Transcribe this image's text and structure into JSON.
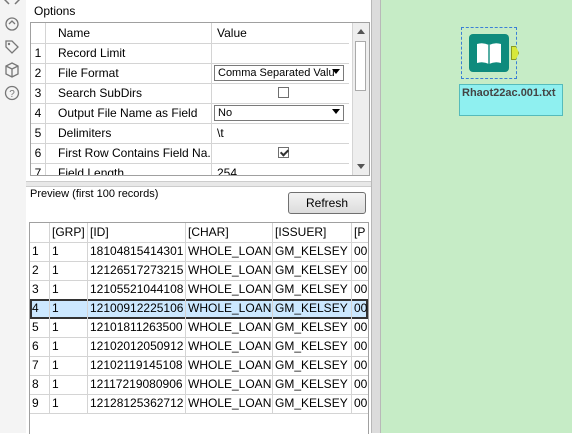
{
  "options": {
    "title": "Options",
    "columns": {
      "name": "Name",
      "value": "Value"
    },
    "rows": [
      {
        "num": "1",
        "name": "Record Limit",
        "value": ""
      },
      {
        "num": "2",
        "name": "File Format",
        "value": "Comma Separated Valu"
      },
      {
        "num": "3",
        "name": "Search SubDirs",
        "value": ""
      },
      {
        "num": "4",
        "name": "Output File Name as Field",
        "value": "No"
      },
      {
        "num": "5",
        "name": "Delimiters",
        "value": "\\t"
      },
      {
        "num": "6",
        "name": "First Row Contains Field Na...",
        "value": ""
      },
      {
        "num": "7",
        "name": "Field Length",
        "value": "254"
      }
    ],
    "checkboxes": {
      "search_subdirs": false,
      "first_row_field_names": true
    }
  },
  "preview": {
    "label": "Preview (first 100 records)",
    "refresh_label": "Refresh",
    "columns": [
      "",
      "[GRP]",
      "[ID]",
      "[CHAR]",
      "[ISSUER]",
      "[P"
    ],
    "rows": [
      [
        "1",
        "1",
        "18104815414301",
        "WHOLE_LOAN",
        "GM_KELSEY",
        "00"
      ],
      [
        "2",
        "1",
        "12126517273215",
        "WHOLE_LOAN",
        "GM_KELSEY",
        "00"
      ],
      [
        "3",
        "1",
        "12105521044108",
        "WHOLE_LOAN",
        "GM_KELSEY",
        "00"
      ],
      [
        "4",
        "1",
        "12100912225106",
        "WHOLE_LOAN",
        "GM_KELSEY",
        "00"
      ],
      [
        "5",
        "1",
        "12101811263500",
        "WHOLE_LOAN",
        "GM_KELSEY",
        "00"
      ],
      [
        "6",
        "1",
        "12102012050912",
        "WHOLE_LOAN",
        "GM_KELSEY",
        "00"
      ],
      [
        "7",
        "1",
        "12102119145108",
        "WHOLE_LOAN",
        "GM_KELSEY",
        "00"
      ],
      [
        "8",
        "1",
        "12117219080906",
        "WHOLE_LOAN",
        "GM_KELSEY",
        "00"
      ],
      [
        "9",
        "1",
        "12128125362712",
        "WHOLE_LOAN",
        "GM_KELSEY",
        "00"
      ]
    ],
    "selected_row": "4"
  },
  "canvas": {
    "tool_label": "Rhaot22ac.001.txt",
    "tool_icon": "input-data-book-icon",
    "background": "#c6ecc6"
  },
  "rail": {
    "icons": [
      "tag-icon",
      "cube-icon",
      "help-icon"
    ]
  }
}
